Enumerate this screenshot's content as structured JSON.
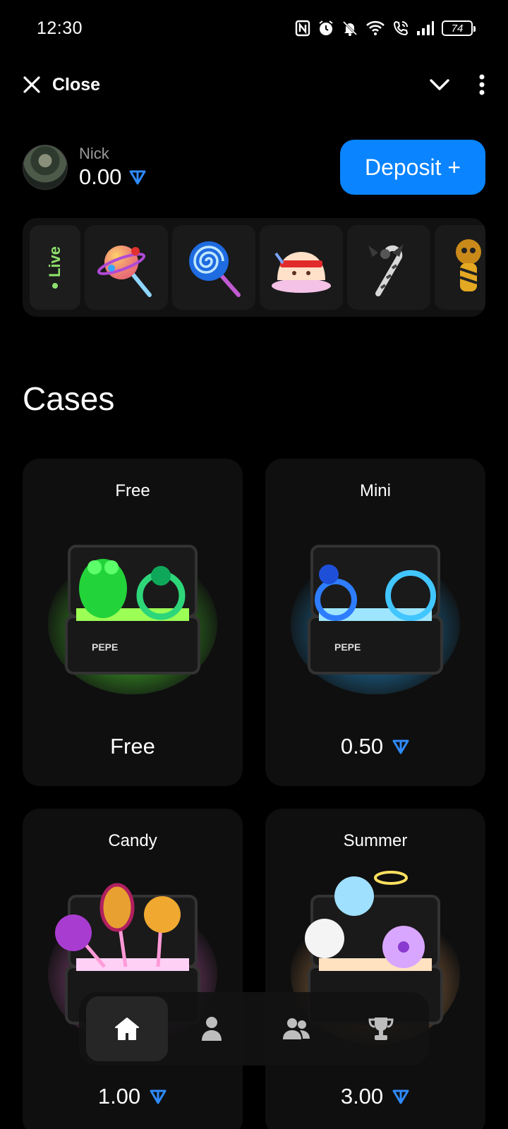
{
  "status_bar": {
    "time": "12:30",
    "battery": "74",
    "icons": [
      "nfc-icon",
      "alarm-icon",
      "mute-icon",
      "wifi-icon",
      "call-icon",
      "signal-icon",
      "battery-icon"
    ]
  },
  "top_bar": {
    "close_label": "Close",
    "icons": [
      "close-icon",
      "chevron-down-icon",
      "more-vertical-icon"
    ]
  },
  "profile": {
    "name": "Nick",
    "balance": "0.00",
    "currency_icon": "ton-icon",
    "deposit_label": "Deposit +"
  },
  "live_feed": {
    "badge": "Live",
    "items": [
      "planet-lollipop",
      "swirl-lollipop",
      "cake-with-headband",
      "candy-cane-with-bow",
      "voodoo-doll"
    ]
  },
  "cases_section": {
    "title": "Cases",
    "cases": [
      {
        "name": "Free",
        "price": "Free",
        "show_currency": false,
        "glow": "#3cff3c"
      },
      {
        "name": "Mini",
        "price": "0.50",
        "show_currency": true,
        "glow": "#2aa8ff"
      },
      {
        "name": "Candy",
        "price": "1.00",
        "show_currency": true,
        "glow": "#ff7adf"
      },
      {
        "name": "Summer",
        "price": "3.00",
        "show_currency": true,
        "glow": "#ffb066"
      }
    ]
  },
  "bottom_nav": {
    "items": [
      "home-icon",
      "profile-icon",
      "friends-icon",
      "trophy-icon"
    ],
    "active": "home-icon"
  },
  "colors": {
    "accent": "#0a84ff",
    "live": "#8ee26b",
    "background": "#000000"
  }
}
